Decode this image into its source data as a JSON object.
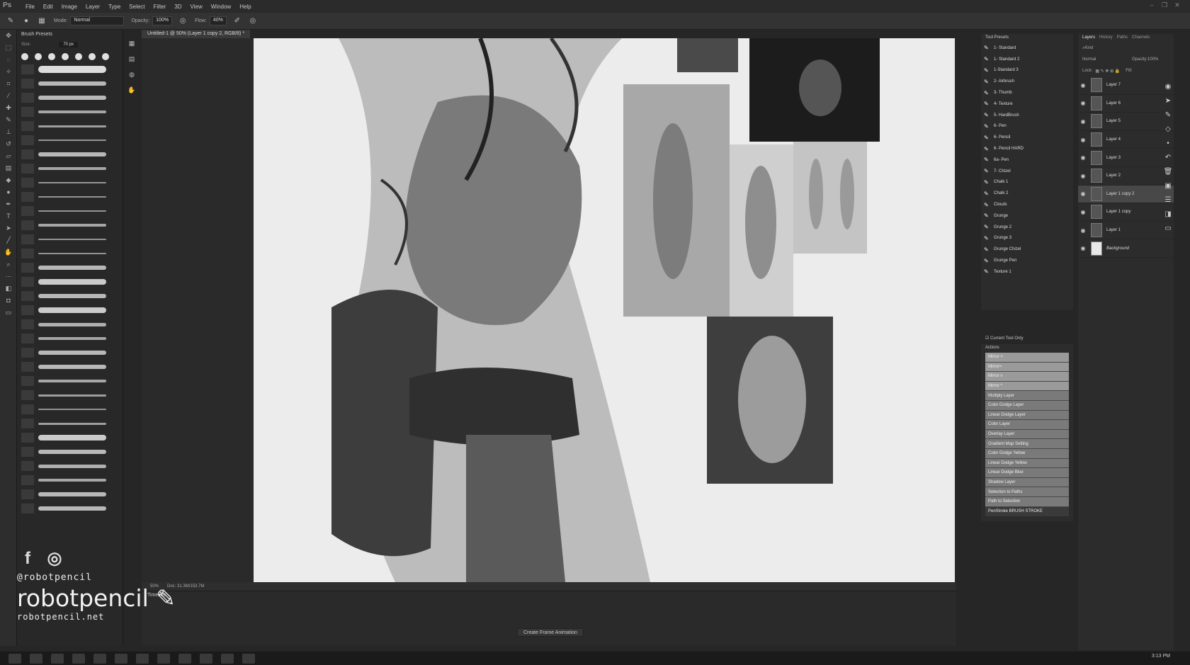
{
  "app": {
    "logo": "Ps",
    "menus": [
      "File",
      "Edit",
      "Image",
      "Layer",
      "Type",
      "Select",
      "Filter",
      "3D",
      "View",
      "Window",
      "Help"
    ]
  },
  "options": {
    "mode_label": "Mode:",
    "mode_value": "Normal",
    "opacity_label": "Opacity:",
    "opacity_value": "100%",
    "flow_label": "Flow:",
    "flow_value": "40%"
  },
  "brush_presets": {
    "title": "Brush Presets",
    "size_label": "Size:",
    "size_value": "70 px"
  },
  "document": {
    "tab_title": "Untitled-1 @ 50% (Layer 1 copy 2, RGB/8) *",
    "zoom": "50%",
    "doc_size": "Doc: 31.3M/153.7M"
  },
  "timeline": {
    "title": "Timeline",
    "create_button": "Create Frame Animation"
  },
  "tool_presets": {
    "title": "Tool Presets",
    "items": [
      "1- Standard",
      "1- Standard 2",
      "1-Standard 3",
      "2- Airbrush",
      "3- Thumb",
      "4- Texture",
      "5- HardBrush",
      "6- Pen",
      "6- Pencil",
      "6- Pencil HARD",
      "6a- Pen",
      "7- Chizel",
      "Chalk 1",
      "Chalk 2",
      "Clouds",
      "Grunge",
      "Grunge 2",
      "Grunge 3",
      "Grunge Chizel",
      "Grunge Pen",
      "Texture 1"
    ],
    "current_tool_only": "Current Tool Only"
  },
  "actions": {
    "title": "Actions",
    "items": [
      "Mirror <",
      "Mirror>",
      "Mirror v",
      "Mirror ^",
      "Multiply Layer",
      "Color Dodge Layer",
      "Linear Dodge Layer",
      "Color Layer",
      "Overlay Layer",
      "Gradient Map Setting",
      "Color Dodge Yellow",
      "Linear Dodge Yellow",
      "Linear Dodge Blue",
      "Shadow Layer",
      "Selection to Paths",
      "Path to Selection",
      "PenStroke BRUSH STROKE"
    ]
  },
  "layers_panel": {
    "tabs": [
      "Layers",
      "History",
      "Paths",
      "Channels"
    ],
    "filter_label": "Kind",
    "blend_mode": "Normal",
    "opacity_label": "Opacity:",
    "opacity_value": "100%",
    "lock_label": "Lock:",
    "fill_label": "Fill:",
    "layers": [
      "Layer 7",
      "Layer 6",
      "Layer 5",
      "Layer 4",
      "Layer 3",
      "Layer 2",
      "Layer 1 copy 2",
      "Layer 1 copy",
      "Layer 1",
      "Background"
    ],
    "selected_layer": "Layer 1 copy 2"
  },
  "watermark": {
    "handle": "@robotpencil",
    "brand": "robotpencil",
    "url": "robotpencil.net"
  },
  "taskbar": {
    "clock": "3:13 PM"
  },
  "colors": {
    "ui_dark": "#262626",
    "panel": "#2c2c2c",
    "canvas": "#ececec",
    "action_button": "#7a7a7a"
  }
}
